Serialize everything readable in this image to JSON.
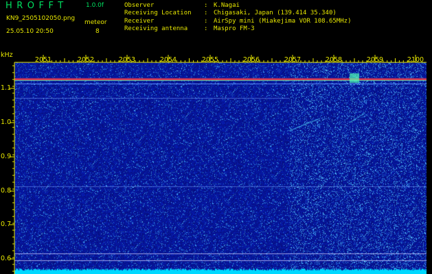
{
  "app": {
    "title": "HROFFT",
    "version": "1.0.0f",
    "filename": "KN9_2505102050.png",
    "datetime": "25.05.10 20:50",
    "mode_label": "meteor",
    "mode_value": "8"
  },
  "station_info": [
    {
      "key": "Observer",
      "value": "K.Nagai"
    },
    {
      "key": "Receiving Location",
      "value": "Chigasaki, Japan (139.414 35.340)"
    },
    {
      "key": "Receiver",
      "value": "AirSpy mini (Miakejima VOR 108.65MHz)"
    },
    {
      "key": "Receiving antenna",
      "value": "Maspro FM-3"
    }
  ],
  "axis": {
    "unit": "kHz",
    "time_ticks": [
      "2051",
      "2052",
      "2053",
      "2054",
      "2055",
      "2056",
      "2057",
      "2058",
      "2059",
      "2100"
    ],
    "freq_ticks": [
      "1.1",
      "1.0",
      "0.9",
      "0.8",
      "0.7",
      "0.6"
    ]
  },
  "colors": {
    "background": "#000000",
    "spectrogram_base": "#0a1aa8",
    "title_green": "#00e060",
    "label_yellow": "#e8e800",
    "carrier_red": "#ff3030",
    "floor_cyan": "#00d8ff"
  }
}
